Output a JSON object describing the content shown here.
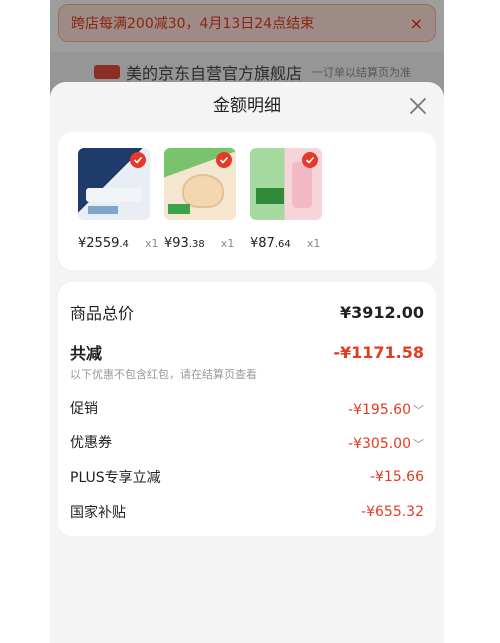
{
  "background": {
    "banner_text": "跨店每满200减30，4月13日24点结束",
    "banner_close": "×",
    "store_name": "美的京东自营官方旗舰店",
    "store_note": "一订单以结算页为准"
  },
  "sheet": {
    "title": "金额明细"
  },
  "products": [
    {
      "price_int": "¥2559",
      "price_dec": ".4",
      "qty": "x1",
      "colors": [
        "#1e3b6c",
        "#e9eef4"
      ]
    },
    {
      "price_int": "¥93",
      "price_dec": ".38",
      "qty": "x1",
      "colors": [
        "#79c36e",
        "#f4e6cf"
      ]
    },
    {
      "price_int": "¥87",
      "price_dec": ".64",
      "qty": "x1",
      "colors": [
        "#a6d9a0",
        "#f7d3da"
      ]
    }
  ],
  "summary": {
    "total_label": "商品总价",
    "total_value": "¥3912.00",
    "discount_label": "共减",
    "discount_value": "-¥1171.58",
    "discount_note": "以下优惠不包含红包，请在结算页查看",
    "items": [
      {
        "label": "促销",
        "value": "-¥195.60",
        "expandable": true
      },
      {
        "label": "优惠券",
        "value": "-¥305.00",
        "expandable": true
      },
      {
        "label": "PLUS专享立减",
        "value": "-¥15.66",
        "expandable": false
      },
      {
        "label": "国家补贴",
        "value": "-¥655.32",
        "expandable": false
      }
    ]
  },
  "colors": {
    "accent_red": "#e33b22",
    "sheet_bg": "#f4f4f4"
  }
}
